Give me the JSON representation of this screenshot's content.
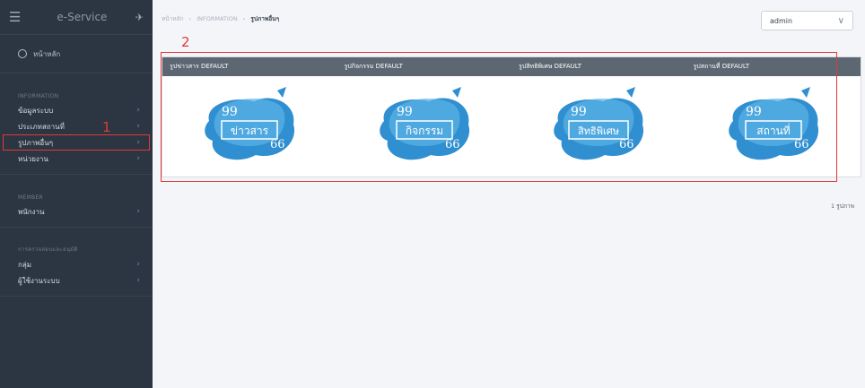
{
  "sidebar": {
    "brand": "e-Service",
    "home_label": "หน้าหลัก",
    "sections": [
      {
        "header": "INFORMATION",
        "items": [
          {
            "label": "ข้อมูลระบบ"
          },
          {
            "label": "ประเภทสถานที่"
          },
          {
            "label": "รูปภาพอื่นๆ"
          },
          {
            "label": "หน่วยงาน"
          }
        ]
      },
      {
        "header": "MEMBER",
        "items": [
          {
            "label": "พนักงาน"
          }
        ]
      },
      {
        "header": "การตรวจสอบและอนุมัติ",
        "items": [
          {
            "label": "กลุ่ม"
          },
          {
            "label": "ผู้ใช้งานระบบ"
          }
        ]
      }
    ]
  },
  "breadcrumb": {
    "home": "หน้าหลัก",
    "section": "INFORMATION",
    "current": "รูปภาพอื่นๆ"
  },
  "user_select": {
    "value": "admin"
  },
  "annotations": {
    "one": "1",
    "two": "2"
  },
  "images": [
    {
      "title": "รูปข่าวสาร DEFAULT",
      "badge": "ข่าวสาร"
    },
    {
      "title": "รูปกิจกรรม DEFAULT",
      "badge": "กิจกรรม"
    },
    {
      "title": "รูปสิทธิพิเศษ DEFAULT",
      "badge": "สิทธิพิเศษ"
    },
    {
      "title": "รูปสถานที่ DEFAULT",
      "badge": "สถานที่"
    }
  ],
  "count_text": "1 รูปภาพ",
  "colors": {
    "sidebar_bg": "#2c3642",
    "accent": "#5c8ed6",
    "highlight": "#e03a3a",
    "panel_header": "#5c6772",
    "splash": "#2f8fd0"
  }
}
